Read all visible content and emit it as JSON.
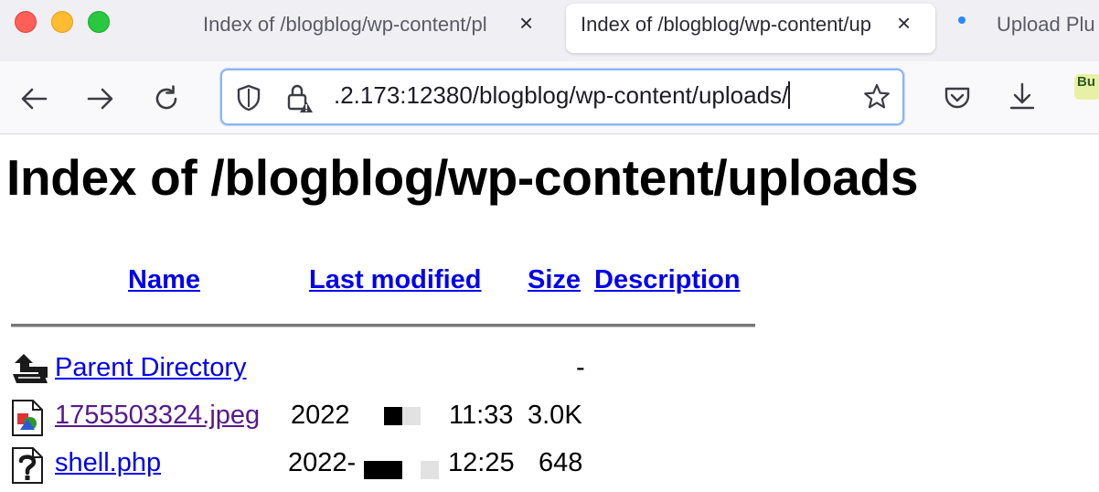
{
  "browser": {
    "tabs": [
      {
        "title": "Index of /blogblog/wp-content/pl",
        "active": false
      },
      {
        "title": "Index of /blogblog/wp-content/up",
        "active": true
      },
      {
        "title": "Upload Plu",
        "active": false
      }
    ],
    "close_glyph": "×",
    "url": ".2.173:12380/blogblog/wp-content/uploads/",
    "extension_badge": "Bu"
  },
  "page": {
    "title": "Index of /blogblog/wp-content/uploads",
    "columns": {
      "name": "Name",
      "last_modified": "Last modified",
      "size": "Size",
      "description": "Description"
    },
    "rows": [
      {
        "icon": "back-folder-icon",
        "name": "Parent Directory",
        "date": "",
        "time": "",
        "size": "-"
      },
      {
        "icon": "image-file-icon",
        "name": "1755503324.jpeg",
        "date": "2022",
        "time": "11:33",
        "size": "3.0K"
      },
      {
        "icon": "unknown-file-icon",
        "name": "shell.php",
        "date": "2022-",
        "time": "12:25",
        "size": "648"
      }
    ]
  },
  "colors": {
    "link": "#0000ee",
    "visited_link": "#551a8b",
    "url_focus_border": "#8bb5f2"
  }
}
